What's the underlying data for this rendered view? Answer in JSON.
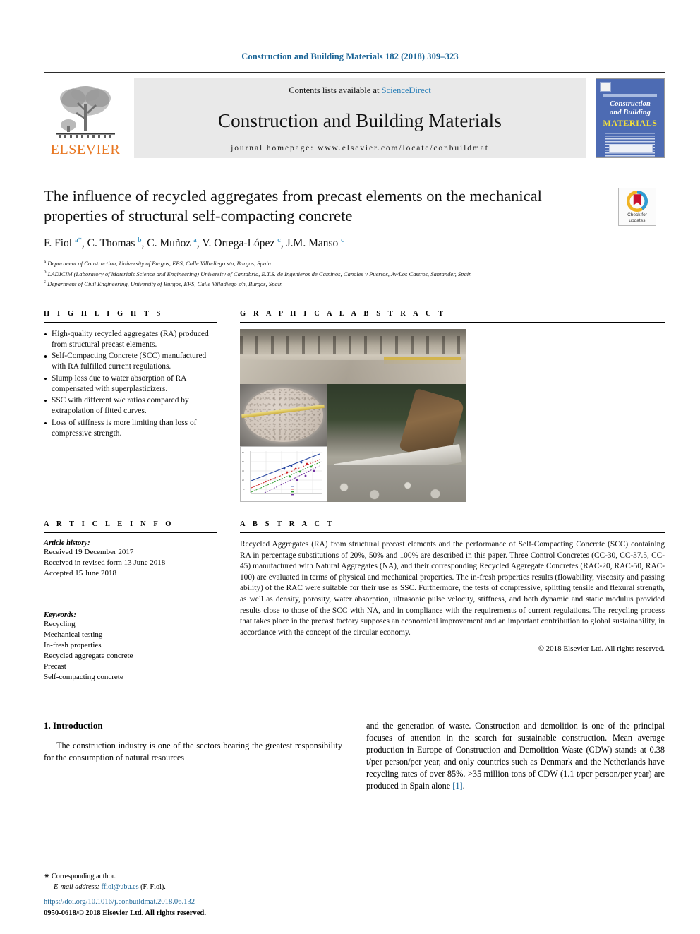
{
  "running_head": "Construction and Building Materials 182 (2018) 309–323",
  "masthead": {
    "publisher_name": "ELSEVIER",
    "contents_prefix": "Contents lists available at ",
    "contents_link": "ScienceDirect",
    "journal_title": "Construction and Building Materials",
    "homepage_line": "journal homepage: www.elsevier.com/locate/conbuildmat",
    "cover": {
      "line1": "Construction",
      "line2": "and Building",
      "line3": "MATERIALS"
    }
  },
  "article": {
    "title": "The influence of recycled aggregates from precast elements on the mechanical properties of structural self-compacting concrete",
    "authors_html": "F. Fiol <sup>a</sup><sup>*</sup>, C. Thomas <sup>b</sup>, C. Muñoz <sup>a</sup>, V. Ortega-López <sup>c</sup>, J.M. Manso <sup>c</sup>",
    "affiliations": [
      "a Department of Construction, University of Burgos, EPS, Calle Villadiego s/n, Burgos, Spain",
      "b LADICIM (Laboratory of Materials Science and Engineering) University of Cantabria, E.T.S. de Ingenieros de Caminos, Canales y Puertos, Av/Los Castros, Santander, Spain",
      "c Department of Civil Engineering, University of Burgos, EPS, Calle Villadiego s/n, Burgos, Spain"
    ],
    "crossmark_label": "Check for\nupdates"
  },
  "highlights": {
    "heading": "H I G H L I G H T S",
    "items": [
      "High-quality recycled aggregates (RA) produced from structural precast elements.",
      "Self-Compacting Concrete (SCC) manufactured with RA fulfilled current regulations.",
      "Slump loss due to water absorption of RA compensated with superplasticizers.",
      "SSC with different w/c ratios compared by extrapolation of fitted curves.",
      "Loss of stiffness is more limiting than loss of compressive strength."
    ]
  },
  "graphical_abstract": {
    "heading": "G R A P H I C A L   A B S T R A C T"
  },
  "article_info": {
    "heading": "A R T I C L E   I N F O",
    "history_label": "Article history:",
    "history": [
      "Received 19 December 2017",
      "Received in revised form 13 June 2018",
      "Accepted 15 June 2018"
    ],
    "keywords_label": "Keywords:",
    "keywords": [
      "Recycling",
      "Mechanical testing",
      "In-fresh properties",
      "Recycled aggregate concrete",
      "Precast",
      "Self-compacting concrete"
    ]
  },
  "abstract": {
    "heading": "A B S T R A C T",
    "text": "Recycled Aggregates (RA) from structural precast elements and the performance of Self-Compacting Concrete (SCC) containing RA in percentage substitutions of 20%, 50% and 100% are described in this paper. Three Control Concretes (CC-30, CC-37.5, CC-45) manufactured with Natural Aggregates (NA), and their corresponding Recycled Aggregate Concretes (RAC-20, RAC-50, RAC-100) are evaluated in terms of physical and mechanical properties. The in-fresh properties results (flowability, viscosity and passing ability) of the RAC were suitable for their use as SSC. Furthermore, the tests of compressive, splitting tensile and flexural strength, as well as density, porosity, water absorption, ultrasonic pulse velocity, stiffness, and both dynamic and static modulus provided results close to those of the SCC with NA, and in compliance with the requirements of current regulations. The recycling process that takes place in the precast factory supposes an economical improvement and an important contribution to global sustainability, in accordance with the concept of the circular economy.",
    "copyright": "© 2018 Elsevier Ltd. All rights reserved."
  },
  "body": {
    "section_number_title": "1. Introduction",
    "col_left_paragraph": "The construction industry is one of the sectors bearing the greatest responsibility for the consumption of natural resources",
    "col_right_paragraph_pre": "and the generation of waste. Construction and demolition is one of the principal focuses of attention in the search for sustainable construction. Mean average production in Europe of Construction and Demolition Waste (CDW) stands at 0.38 t/per person/per year, and only countries such as Denmark and the Netherlands have recycling rates of over 85%. >35 million tons of CDW (1.1 t/per person/per year) are produced in Spain alone ",
    "col_right_reference": "[1]",
    "col_right_paragraph_post": "."
  },
  "footnotes": {
    "corresponding_mark": "⁕",
    "corresponding_label": "Corresponding author.",
    "email_label": "E-mail address:",
    "email": "ffiol@ubu.es",
    "email_owner": "(F. Fiol).",
    "doi": "https://doi.org/10.1016/j.conbuildmat.2018.06.132",
    "issn_line": "0950-0618/© 2018 Elsevier Ltd. All rights reserved."
  },
  "colors": {
    "link_blue": "#1a6496",
    "sciencedirect_blue": "#2a7fb8",
    "elsevier_orange": "#e87722",
    "cover_blue": "#4d6bb3",
    "cover_yellow": "#f4e03a"
  },
  "chart_data": {
    "type": "scatter",
    "title": "",
    "xlabel": "",
    "ylabel": "",
    "series": [
      {
        "name": "series-1",
        "color": "#1f3f9e"
      },
      {
        "name": "series-2",
        "color": "#cc2222"
      },
      {
        "name": "series-3",
        "color": "#2f9e2f"
      },
      {
        "name": "series-4",
        "color": "#7030a0"
      }
    ],
    "note": "Small inset plot in graphical abstract collage: four trend lines with point markers rising left-to-right on a white gridded panel."
  }
}
